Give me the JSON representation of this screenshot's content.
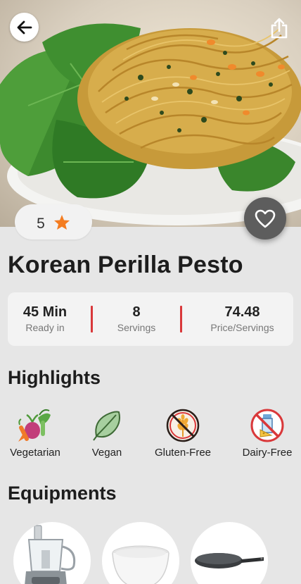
{
  "recipe": {
    "title": "Korean Perilla Pesto",
    "rating": "5"
  },
  "stats": [
    {
      "value": "45 Min",
      "label": "Ready in"
    },
    {
      "value": "8",
      "label": "Servings"
    },
    {
      "value": "74.48",
      "label": "Price/Servings"
    }
  ],
  "highlights": {
    "title": "Highlights",
    "items": [
      {
        "label": "Vegetarian",
        "icon": "vegetables-icon"
      },
      {
        "label": "Vegan",
        "icon": "leaf-icon"
      },
      {
        "label": "Gluten-Free",
        "icon": "no-wheat-icon"
      },
      {
        "label": "Dairy-Free",
        "icon": "no-dairy-icon"
      }
    ]
  },
  "equipments": {
    "title": "Equipments",
    "items": [
      {
        "icon": "food-processor-icon"
      },
      {
        "icon": "bowl-icon"
      },
      {
        "icon": "frying-pan-icon"
      }
    ]
  },
  "colors": {
    "accent_red": "#d9383a",
    "star_orange": "#f47c20",
    "favorite_button": "#5d5d5d",
    "background": "#e6e6e6"
  }
}
